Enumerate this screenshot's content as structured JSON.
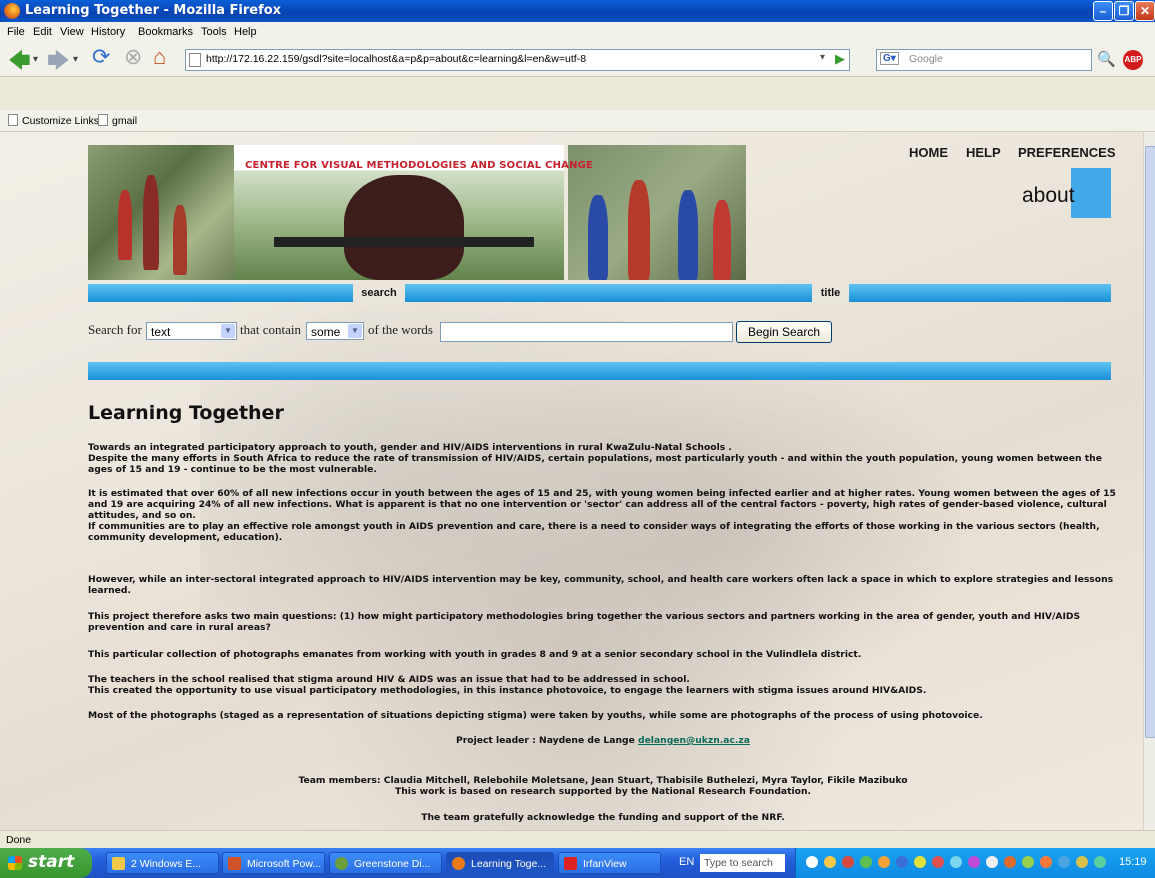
{
  "window": {
    "title": "Learning Together - Mozilla Firefox"
  },
  "menu": [
    "File",
    "Edit",
    "View",
    "History",
    "Bookmarks",
    "Tools",
    "Help"
  ],
  "toolbar": {
    "url": "http://172.16.22.159/gsdl?site=localhost&a=p&p=about&c=learning&l=en&w=utf-8",
    "search_placeholder": "Google"
  },
  "bookmarks": [
    "Customize Links",
    "gmail"
  ],
  "header": {
    "banner_text": "CENTRE FOR VISUAL METHODOLOGIES AND SOCIAL CHANGE",
    "nav": [
      "HOME",
      "HELP",
      "PREFERENCES"
    ],
    "page_label": "about",
    "tabs": [
      "search",
      "title"
    ]
  },
  "search_form": {
    "label_search_for": "Search for",
    "field_value": "text",
    "label_that_contain": "that contain",
    "quantifier_value": "some",
    "label_of_words": "of the words",
    "query_value": "",
    "button": "Begin Search"
  },
  "page": {
    "title": "Learning Together",
    "paragraphs": [
      "Towards an integrated participatory approach to youth, gender and HIV/AIDS interventions in rural KwaZulu-Natal Schools .",
      "Despite the many efforts in South Africa to reduce the rate of transmission of HIV/AIDS, certain populations, most particularly youth - and within the youth population, young women between the ages of 15 and 19 - continue to be the most vulnerable.",
      "It is estimated that over 60% of all new infections occur in youth between the ages of 15 and 25, with young women being infected earlier and at higher rates. Young women between the ages of 15 and 19 are acquiring 24% of all new infections. What is apparent is that no one intervention or 'sector' can address all of the central factors - poverty, high rates of gender-based violence, cultural attitudes, and so on.",
      "If communities are to play an effective role amongst youth in AIDS prevention and care, there is a need to consider ways of integrating the efforts of those working in the various sectors (health, community development, education).",
      "However, while an inter-sectoral integrated approach to HIV/AIDS intervention may be key, community, school, and health care workers often lack a space in which to explore strategies and lessons learned.",
      "This project therefore asks two main questions: (1) how might participatory methodologies bring together the various sectors and partners working in the area of gender, youth and HIV/AIDS prevention and care in rural areas?",
      "This particular collection of photographs emanates from working with youth in grades 8 and 9 at a senior secondary school in the Vulindlela district.",
      "The teachers in the school realised that stigma around HIV & AIDS was an issue that had to be addressed in school.",
      "This created the opportunity to use visual participatory methodologies, in this instance photovoice, to engage the learners with stigma issues around HIV&AIDS.",
      "Most of the photographs (staged as a representation of situations depicting stigma) were taken by youths, while some are photographs of the process of using photovoice."
    ],
    "leader_label": "Project leader : Naydene de Lange",
    "leader_email": "delangen@ukzn.ac.za",
    "team": "Team members: Claudia Mitchell, Relebohile Moletsane, Jean Stuart, Thabisile Buthelezi, Myra Taylor, Fikile Mazibuko",
    "research_note": "This work is based on research supported by the National Research Foundation.",
    "acknowledge": "The team gratefully acknowledge the funding and support of the NRF."
  },
  "status": {
    "text": "Done"
  },
  "taskbar": {
    "start": "start",
    "tasks": [
      "2 Windows E...",
      "Microsoft Pow...",
      "Greenstone Di...",
      "Learning Toge...",
      "IrfanView"
    ],
    "lang": "EN",
    "search_placeholder": "Type to search",
    "clock": "15:19"
  }
}
